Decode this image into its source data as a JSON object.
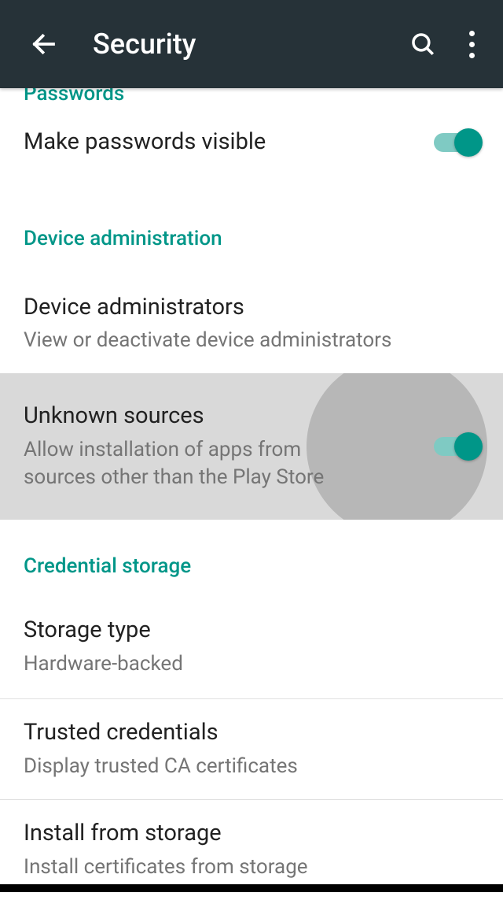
{
  "header": {
    "title": "Security"
  },
  "sections": {
    "passwords": {
      "header": "Passwords",
      "make_visible": {
        "title": "Make passwords visible"
      }
    },
    "device_admin": {
      "header": "Device administration",
      "administrators": {
        "title": "Device administrators",
        "subtitle": "View or deactivate device administrators"
      },
      "unknown_sources": {
        "title": "Unknown sources",
        "subtitle": "Allow installation of apps from sources other than the Play Store"
      }
    },
    "credential": {
      "header": "Credential storage",
      "storage_type": {
        "title": "Storage type",
        "subtitle": "Hardware-backed"
      },
      "trusted": {
        "title": "Trusted credentials",
        "subtitle": "Display trusted CA certificates"
      },
      "install": {
        "title": "Install from storage",
        "subtitle": "Install certificates from storage"
      }
    }
  }
}
